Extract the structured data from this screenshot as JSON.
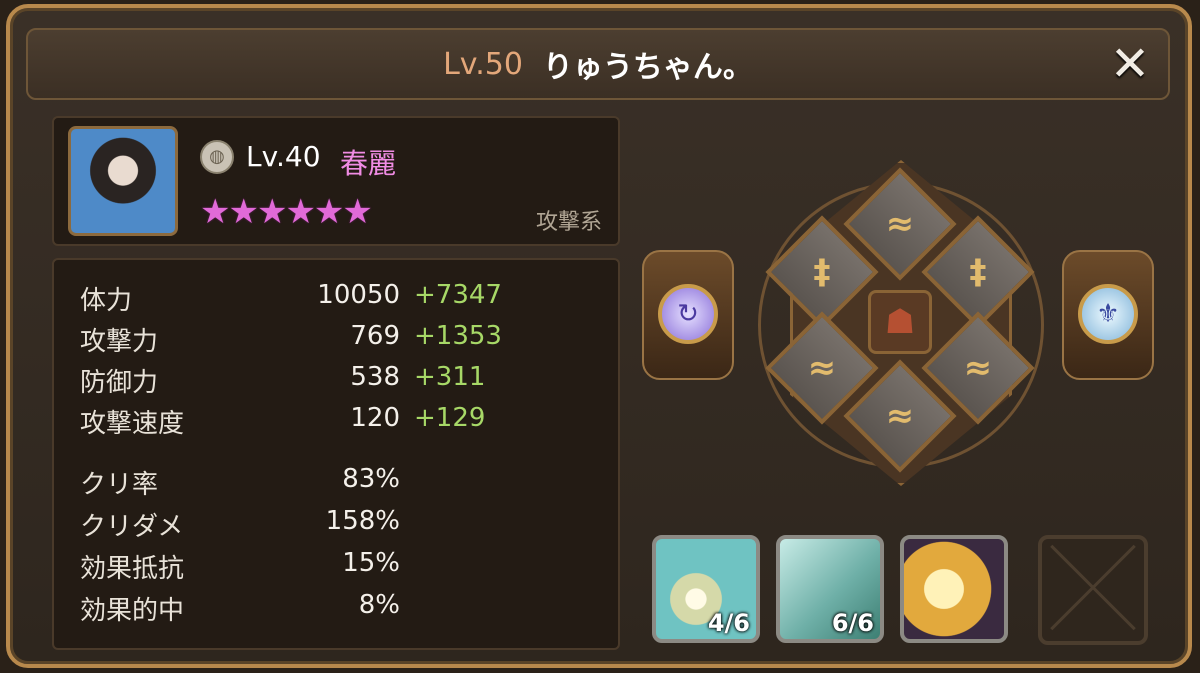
{
  "header": {
    "level": "Lv.50",
    "player_name": "りゅうちゃん。",
    "close_symbol": "✕"
  },
  "monster": {
    "level": "Lv.40",
    "name": "春麗",
    "stars": "★★★★★★",
    "star_count": 6,
    "type": "攻撃系",
    "element_icon": "wind-element-icon"
  },
  "stats": [
    {
      "label": "体力",
      "value": "10050",
      "bonus": "+7347"
    },
    {
      "label": "攻撃力",
      "value": "769",
      "bonus": "+1353"
    },
    {
      "label": "防御力",
      "value": "538",
      "bonus": "+311"
    },
    {
      "label": "攻撃速度",
      "value": "120",
      "bonus": "+129"
    }
  ],
  "secondary_stats": [
    {
      "label": "クリ率",
      "value": "83%"
    },
    {
      "label": "クリダメ",
      "value": "158%"
    },
    {
      "label": "効果抵抗",
      "value": "15%"
    },
    {
      "label": "効果的中",
      "value": "8%"
    }
  ],
  "runes": {
    "slot_symbols": [
      "≈",
      "‡",
      "‡",
      "≈",
      "≈",
      "≈"
    ],
    "center_symbol": "☗",
    "left_gem_symbol": "↻",
    "right_gem_symbol": "⚜"
  },
  "skills": [
    {
      "count": "4/6"
    },
    {
      "count": "6/6"
    },
    {
      "count": ""
    }
  ],
  "colors": {
    "accent_gold": "#b8894c",
    "name_pink": "#f08ce4",
    "bonus_green": "#a7d867",
    "level_orange": "#e3a77a"
  }
}
